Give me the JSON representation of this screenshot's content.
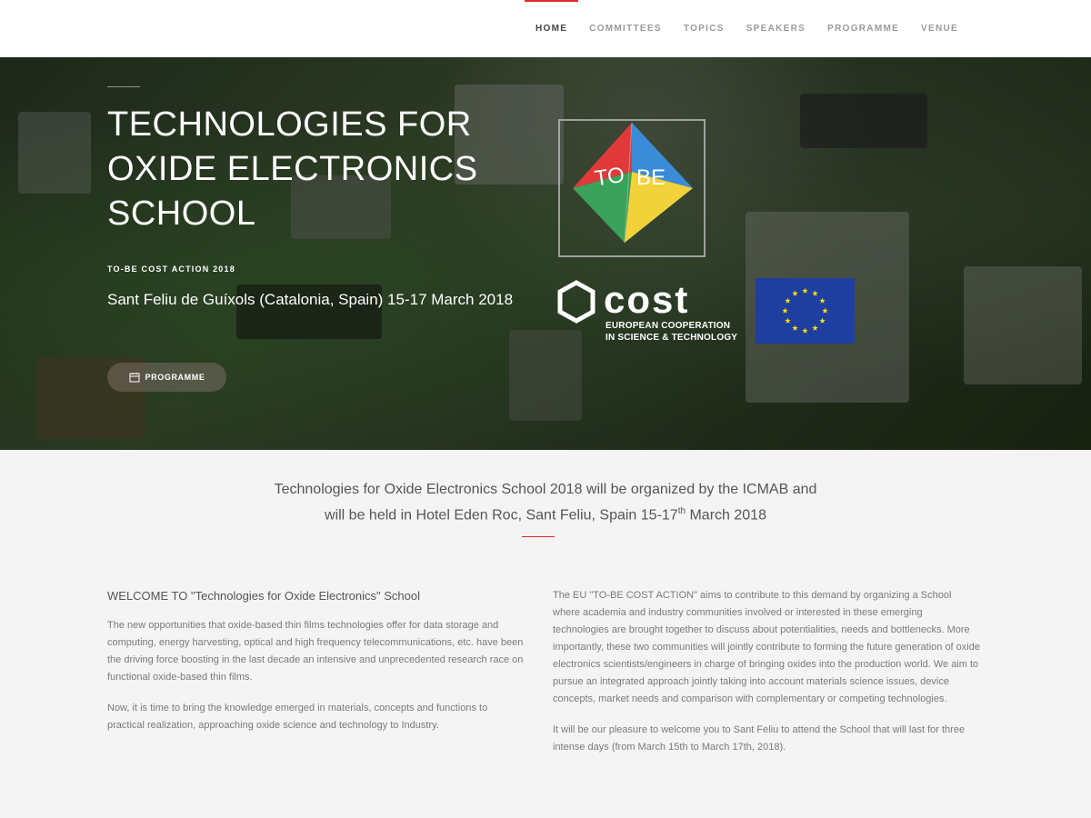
{
  "nav": {
    "items": [
      "HOME",
      "COMMITTEES",
      "TOPICS",
      "SPEAKERS",
      "PROGRAMME",
      "VENUE"
    ],
    "active": "HOME"
  },
  "hero": {
    "title": "TECHNOLOGIES FOR OXIDE ELECTRONICS SCHOOL",
    "kicker": "TO-BE COST ACTION 2018",
    "subtitle": "Sant Feliu de Guíxols (Catalonia, Spain) 15-17 March 2018",
    "button_label": "PROGRAMME",
    "button_icon": "calendar-icon",
    "logos": {
      "tobe_text_1": "TO",
      "tobe_text_2": "BE",
      "cost_word": "cost",
      "cost_line1": "EUROPEAN COOPERATION",
      "cost_line2": "IN SCIENCE & TECHNOLOGY"
    }
  },
  "intro": {
    "line1": "Technologies for Oxide Electronics School 2018 will be organized by the ICMAB and",
    "line2_pre": "will be held in Hotel Eden Roc, Sant Feliu, Spain 15-17",
    "line2_sup": "th",
    "line2_post": " March 2018"
  },
  "left": {
    "heading": "WELCOME TO \"Technologies for Oxide Electronics\" School",
    "p1": "The new opportunities that oxide-based thin films technologies offer for data storage and computing, energy harvesting, optical and high frequency telecommunications, etc. have been the driving force boosting in the last decade an intensive and unprecedented research race on functional oxide-based thin films.",
    "p2": "Now, it is time to bring the knowledge emerged in materials, concepts and functions to practical realization, approaching oxide science and technology to Industry."
  },
  "right": {
    "p1": "The EU \"TO-BE COST ACTION\" aims to contribute to this demand by organizing a School where academia and industry communities involved or interested in these emerging technologies are brought together to discuss about potentialities, needs and bottlenecks. More importantly, these two communities will jointly contribute to forming the future generation of oxide electronics scientists/engineers in charge of bringing oxides into the production world. We aim to pursue an integrated approach jointly taking into account materials science issues, device concepts, market needs and comparison with complementary or competing technologies.",
    "p2": "It will be our pleasure to welcome you to Sant Feliu to attend the School that will last for three intense days (from March 15th to March 17th, 2018)."
  },
  "colors": {
    "accent": "#e02a2a",
    "eu_blue": "#1f3fa0",
    "eu_star": "#ffdd00"
  }
}
